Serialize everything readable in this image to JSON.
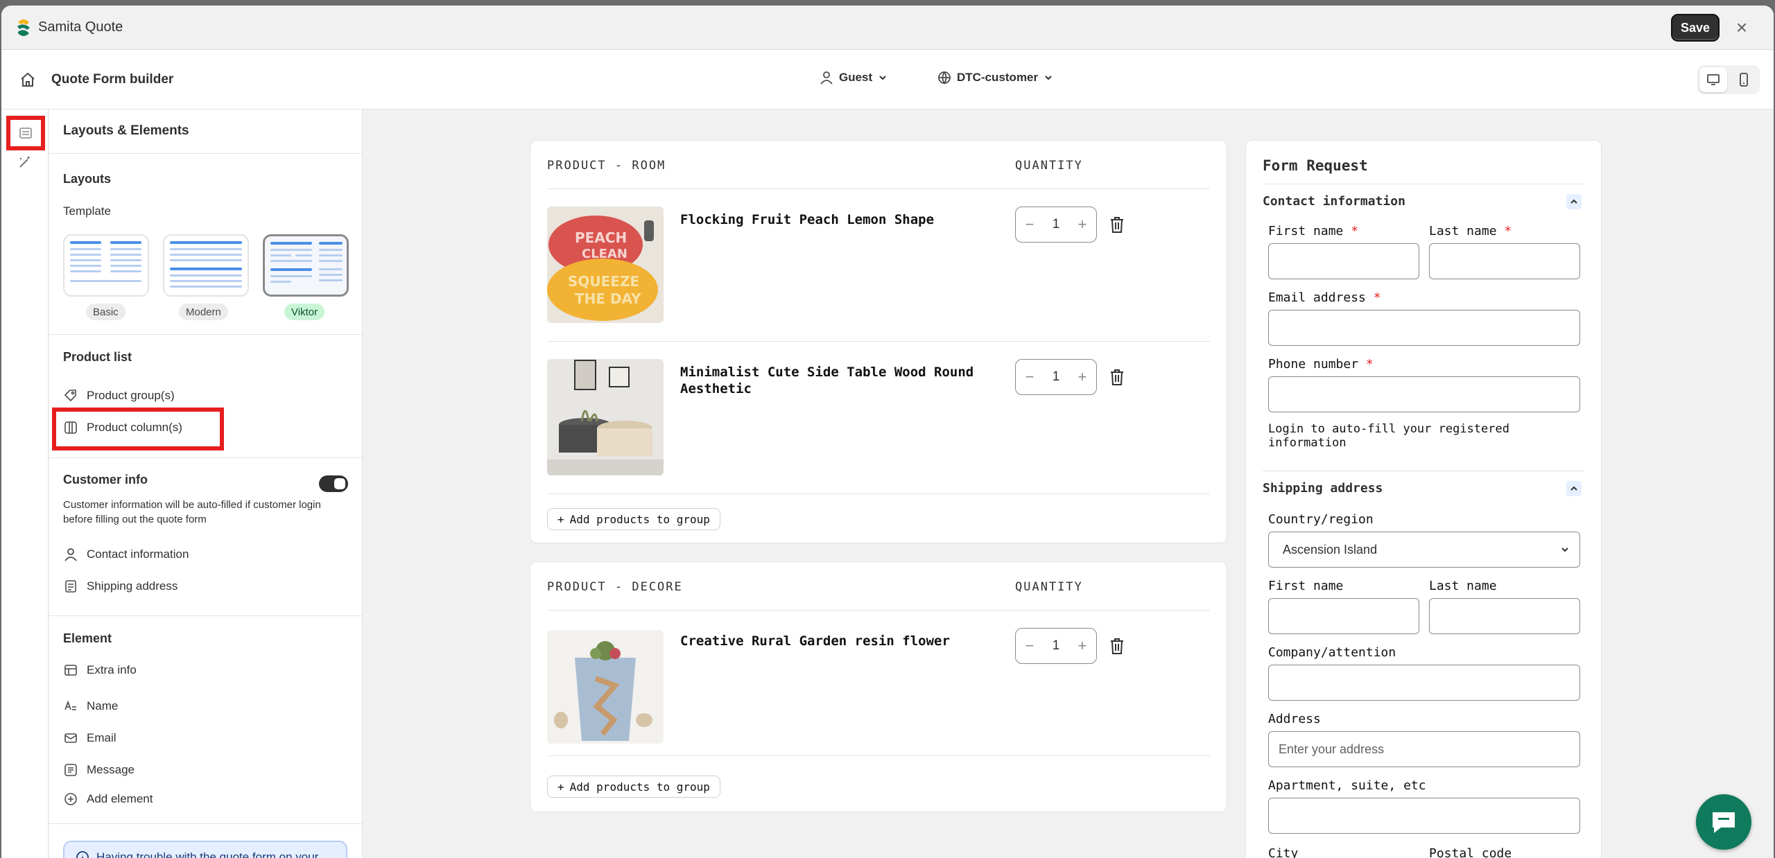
{
  "app": {
    "name": "Samita Quote",
    "save_label": "Save",
    "close_icon": "close-icon"
  },
  "header": {
    "title": "Quote Form builder",
    "customer_type": "Guest",
    "market": "DTC-customer"
  },
  "sidebar": {
    "title": "Layouts & Elements",
    "layouts_title": "Layouts",
    "template_label": "Template",
    "templates": [
      {
        "label": "Basic"
      },
      {
        "label": "Modern"
      },
      {
        "label": "Viktor",
        "selected": true
      }
    ],
    "product_list_title": "Product list",
    "product_groups": "Product group(s)",
    "product_columns": "Product column(s)",
    "customer_info_title": "Customer info",
    "customer_info_enabled": true,
    "customer_info_desc": "Customer information will be auto-filled if customer login before filling out the quote form",
    "contact_information": "Contact information",
    "shipping_address": "Shipping address",
    "element_title": "Element",
    "elements": [
      "Extra info",
      "Name",
      "Email",
      "Message"
    ],
    "add_element": "Add element",
    "help_text": "Having trouble with the quote form on your"
  },
  "groups": [
    {
      "title": "PRODUCT - ROOM",
      "quantity_header": "QUANTITY",
      "products": [
        {
          "name": "Flocking Fruit Peach Lemon Shape",
          "qty": "1"
        },
        {
          "name": "Minimalist Cute Side Table Wood Round Aesthetic",
          "qty": "1"
        }
      ],
      "add_label": "Add products to group"
    },
    {
      "title": "PRODUCT - DECORE",
      "quantity_header": "QUANTITY",
      "products": [
        {
          "name": "Creative Rural Garden resin flower",
          "qty": "1"
        }
      ],
      "add_label": "Add products to group"
    }
  ],
  "form": {
    "title": "Form Request",
    "contact_section": "Contact information",
    "first_name": "First name",
    "last_name": "Last name",
    "email": "Email address",
    "phone": "Phone number",
    "login_note": "Login to auto-fill your registered information",
    "shipping_section": "Shipping address",
    "country_label": "Country/region",
    "country_value": "Ascension Island",
    "ship_first_name": "First name",
    "ship_last_name": "Last name",
    "company": "Company/attention",
    "address": "Address",
    "address_placeholder": "Enter your address",
    "apartment": "Apartment, suite, etc",
    "city": "City",
    "postal": "Postal code",
    "required_mark": "*"
  },
  "colors": {
    "accent_red": "#e61e1e",
    "dark_button": "#303030",
    "chat_green": "#0f7a5c",
    "badge_green": "#c9f5d4"
  }
}
